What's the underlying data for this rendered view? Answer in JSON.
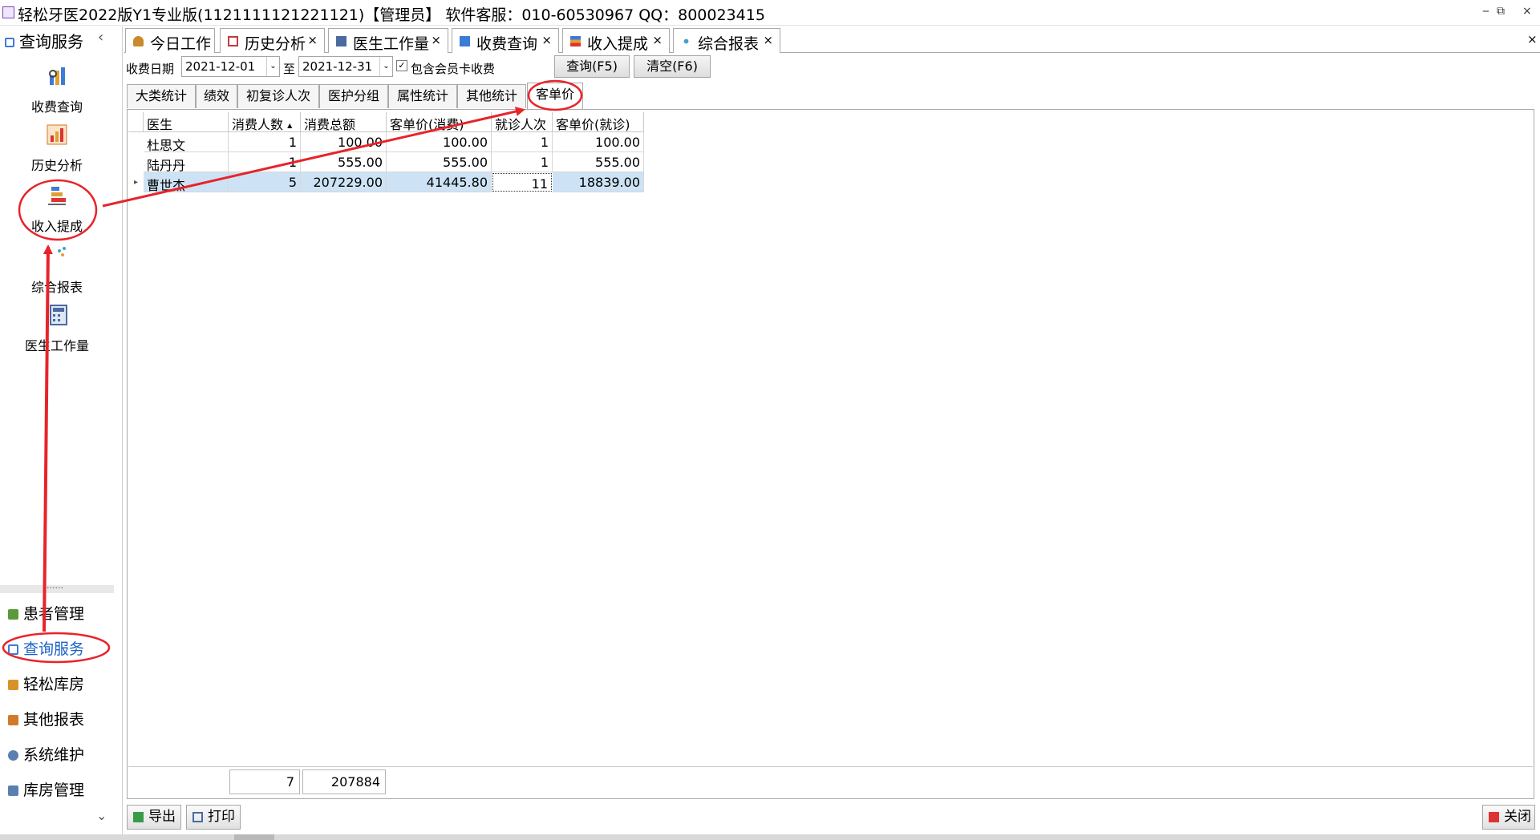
{
  "window": {
    "title": "轻松牙医2022版Y1专业版(1121111121221121)【管理员】    软件客服：010-60530967 QQ：800023415"
  },
  "sidebar": {
    "header": "查询服务",
    "collapse_glyph": "‹",
    "tools": [
      {
        "label": "收费查询",
        "icon": "bar-chart-search-icon"
      },
      {
        "label": "历史分析",
        "icon": "chart-analysis-icon"
      },
      {
        "label": "收入提成",
        "icon": "stacked-bars-icon"
      },
      {
        "label": "综合报表",
        "icon": "scatter-dots-icon"
      },
      {
        "label": "医生工作量",
        "icon": "calculator-doctor-icon"
      }
    ],
    "separator": "......",
    "nav": [
      {
        "label": "患者管理",
        "icon": "people-icon",
        "color": "#5a9a3a"
      },
      {
        "label": "查询服务",
        "icon": "magnifier-icon",
        "color": "#3d7bd6",
        "active": true
      },
      {
        "label": "轻松库房",
        "icon": "box-icon",
        "color": "#d8922a"
      },
      {
        "label": "其他报表",
        "icon": "report-icon",
        "color": "#d07a2a"
      },
      {
        "label": "系统维护",
        "icon": "gears-icon",
        "color": "#5a7fb0"
      },
      {
        "label": "库房管理",
        "icon": "warehouse-icon",
        "color": "#5a7fb0"
      }
    ],
    "scroll_down": "⌄"
  },
  "doc_tabs": [
    {
      "label": "今日工作",
      "icon": "person-icon",
      "color": "#c98a2b"
    },
    {
      "label": "历史分析",
      "icon": "chart-icon",
      "color": "#c23b3b"
    },
    {
      "label": "医生工作量",
      "icon": "calculator-icon",
      "color": "#4a6aa0"
    },
    {
      "label": "收费查询",
      "icon": "bar-search-icon",
      "color": "#3d7bd6"
    },
    {
      "label": "收入提成",
      "icon": "stacked-bars-icon",
      "color": "#3d7bd6",
      "active": true
    },
    {
      "label": "综合报表",
      "icon": "dots-icon",
      "color": "#45a0c8"
    }
  ],
  "tab_close": "×",
  "filters": {
    "date_label": "收费日期",
    "date_from": "2021-12-01",
    "to_label": "至",
    "date_to": "2021-12-31",
    "include_member_label": "包含会员卡收费",
    "include_member_checked": true,
    "check_mark": "✓",
    "dropdown_glyph": "⌄",
    "query_button": "查询(F5)",
    "clear_button": "清空(F6)"
  },
  "sub_tabs": [
    "大类统计",
    "绩效",
    "初复诊人次",
    "医护分组",
    "属性统计",
    "其他统计",
    "客单价"
  ],
  "active_sub_tab": "客单价",
  "table": {
    "columns": [
      "医生",
      "消费人数",
      "消费总额",
      "客单价(消费)",
      "就诊人次",
      "客单价(就诊)"
    ],
    "sort_glyph": "▲",
    "rows": [
      {
        "doctor": "杜思文",
        "consumers": "1",
        "total": "100.00",
        "avg_consume": "100.00",
        "visits": "1",
        "avg_visit": "100.00"
      },
      {
        "doctor": "陆丹丹",
        "consumers": "1",
        "total": "555.00",
        "avg_consume": "555.00",
        "visits": "1",
        "avg_visit": "555.00"
      },
      {
        "doctor": "曹世杰",
        "consumers": "5",
        "total": "207229.00",
        "avg_consume": "41445.80",
        "visits": "11",
        "avg_visit": "18839.00"
      }
    ],
    "row_marker": "▸",
    "footer": {
      "consumers": "7",
      "total": "207884"
    }
  },
  "bottom": {
    "export": "导出",
    "print": "打印",
    "close": "关闭"
  },
  "window_controls": {
    "minimize": "‒",
    "restore": "⧉",
    "close": "×"
  },
  "annotations": {
    "color": "#e8232a"
  }
}
